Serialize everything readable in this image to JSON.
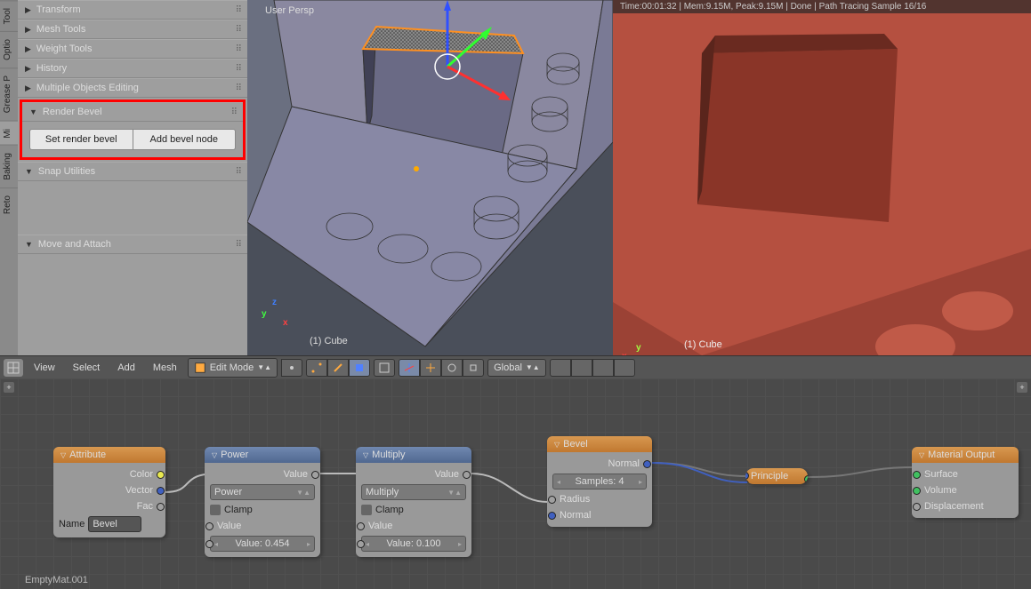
{
  "side_tabs": [
    "Tool",
    "Optio",
    "Grease P",
    "Mi",
    "Baking",
    "Reto"
  ],
  "panels": {
    "transform": "Transform",
    "mesh_tools": "Mesh Tools",
    "weight_tools": "Weight Tools",
    "history": "History",
    "multi_obj": "Multiple Objects Editing",
    "render_bevel": "Render Bevel",
    "snap_util": "Snap Utilities",
    "move_attach": "Move and Attach"
  },
  "render_bevel": {
    "btn1": "Set render bevel",
    "btn2": "Add bevel node"
  },
  "viewport": {
    "persp": "User Persp",
    "obj": "(1) Cube"
  },
  "render": {
    "stats": "Time:00:01:32 | Mem:9.15M, Peak:9.15M | Done | Path Tracing Sample 16/16",
    "obj": "(1) Cube"
  },
  "header": {
    "view": "View",
    "select": "Select",
    "add": "Add",
    "mesh": "Mesh",
    "mode": "Edit Mode",
    "orientation": "Global"
  },
  "node_editor": {
    "material": "EmptyMat.001"
  },
  "nodes": {
    "attribute": {
      "title": "Attribute",
      "color": "Color",
      "vector": "Vector",
      "fac": "Fac",
      "name_label": "Name",
      "name_value": "Bevel"
    },
    "power": {
      "title": "Power",
      "value_out": "Value",
      "op": "Power",
      "clamp": "Clamp",
      "value_label": "Value",
      "value_num_label": "Value:",
      "value_num": "0.454"
    },
    "multiply": {
      "title": "Multiply",
      "value_out": "Value",
      "op": "Multiply",
      "clamp": "Clamp",
      "value_label": "Value",
      "value_num_label": "Value:",
      "value_num": "0.100"
    },
    "bevel": {
      "title": "Bevel",
      "normal_out": "Normal",
      "samples_label": "Samples:",
      "samples_val": "4",
      "radius": "Radius",
      "normal_in": "Normal"
    },
    "principle": {
      "title": "Principle"
    },
    "output": {
      "title": "Material Output",
      "surface": "Surface",
      "volume": "Volume",
      "displacement": "Displacement"
    }
  }
}
